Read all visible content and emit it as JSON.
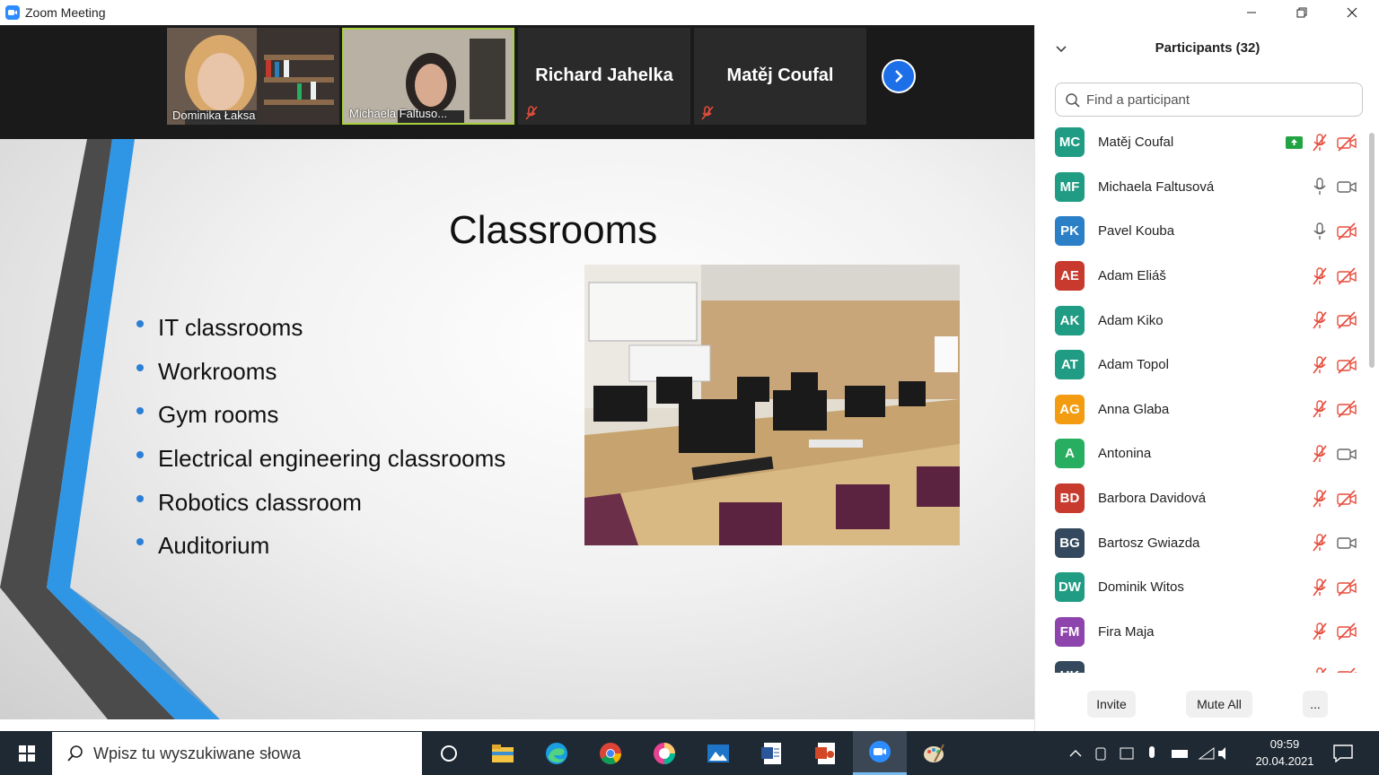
{
  "window": {
    "title": "Zoom Meeting"
  },
  "videos": [
    {
      "name": "Dominika Łaksa",
      "active": false,
      "has_video": true
    },
    {
      "name": "Michaela Faltuso...",
      "active": true,
      "has_video": true
    },
    {
      "name": "Richard Jahelka",
      "active": false,
      "has_video": false
    },
    {
      "name": "Matěj Coufal",
      "active": false,
      "has_video": false
    }
  ],
  "slide": {
    "title": "Classrooms",
    "bullets": [
      "IT classrooms",
      "Workrooms",
      "Gym rooms",
      "Electrical engineering classrooms",
      "Robotics classroom",
      "Auditorium"
    ]
  },
  "participants_panel": {
    "title": "Participants (32)",
    "search_placeholder": "Find a participant",
    "participants": [
      {
        "initials": "MC",
        "name": "Matěj Coufal",
        "color": "#1f9c83",
        "mic": "muted",
        "cam": "off",
        "sharing": true
      },
      {
        "initials": "MF",
        "name": "Michaela Faltusová",
        "color": "#1f9c83",
        "mic": "on",
        "cam": "on",
        "sharing": false
      },
      {
        "initials": "PK",
        "name": "Pavel Kouba",
        "color": "#2b7fc7",
        "mic": "on",
        "cam": "off",
        "sharing": false
      },
      {
        "initials": "AE",
        "name": "Adam Eliáš",
        "color": "#c8392e",
        "mic": "muted",
        "cam": "off",
        "sharing": false
      },
      {
        "initials": "AK",
        "name": "Adam Kiko",
        "color": "#1f9c83",
        "mic": "muted",
        "cam": "off",
        "sharing": false
      },
      {
        "initials": "AT",
        "name": "Adam Topol",
        "color": "#1f9c83",
        "mic": "muted",
        "cam": "off",
        "sharing": false
      },
      {
        "initials": "AG",
        "name": "Anna Glaba",
        "color": "#f39c12",
        "mic": "muted",
        "cam": "off",
        "sharing": false
      },
      {
        "initials": "A",
        "name": "Antonina",
        "color": "#27ae60",
        "mic": "muted",
        "cam": "on",
        "sharing": false
      },
      {
        "initials": "BD",
        "name": "Barbora Davidová",
        "color": "#c8392e",
        "mic": "muted",
        "cam": "off",
        "sharing": false
      },
      {
        "initials": "BG",
        "name": "Bartosz Gwiazda",
        "color": "#34495e",
        "mic": "muted",
        "cam": "on",
        "sharing": false
      },
      {
        "initials": "DW",
        "name": "Dominik Witos",
        "color": "#1f9c83",
        "mic": "muted",
        "cam": "off",
        "sharing": false
      },
      {
        "initials": "FM",
        "name": "Fira Maja",
        "color": "#8e44ad",
        "mic": "muted",
        "cam": "off",
        "sharing": false
      },
      {
        "initials": "HK",
        "name": "",
        "color": "#34495e",
        "mic": "muted",
        "cam": "off",
        "sharing": false
      }
    ],
    "invite_label": "Invite",
    "mute_all_label": "Mute All",
    "more_label": "..."
  },
  "taskbar": {
    "search_placeholder": "Wpisz tu wyszukiwane słowa",
    "time": "09:59",
    "date": "20.04.2021"
  },
  "colors": {
    "zoom_blue": "#2d8cff",
    "muted_red": "#e74c3c",
    "active_border": "#a7d13d"
  }
}
